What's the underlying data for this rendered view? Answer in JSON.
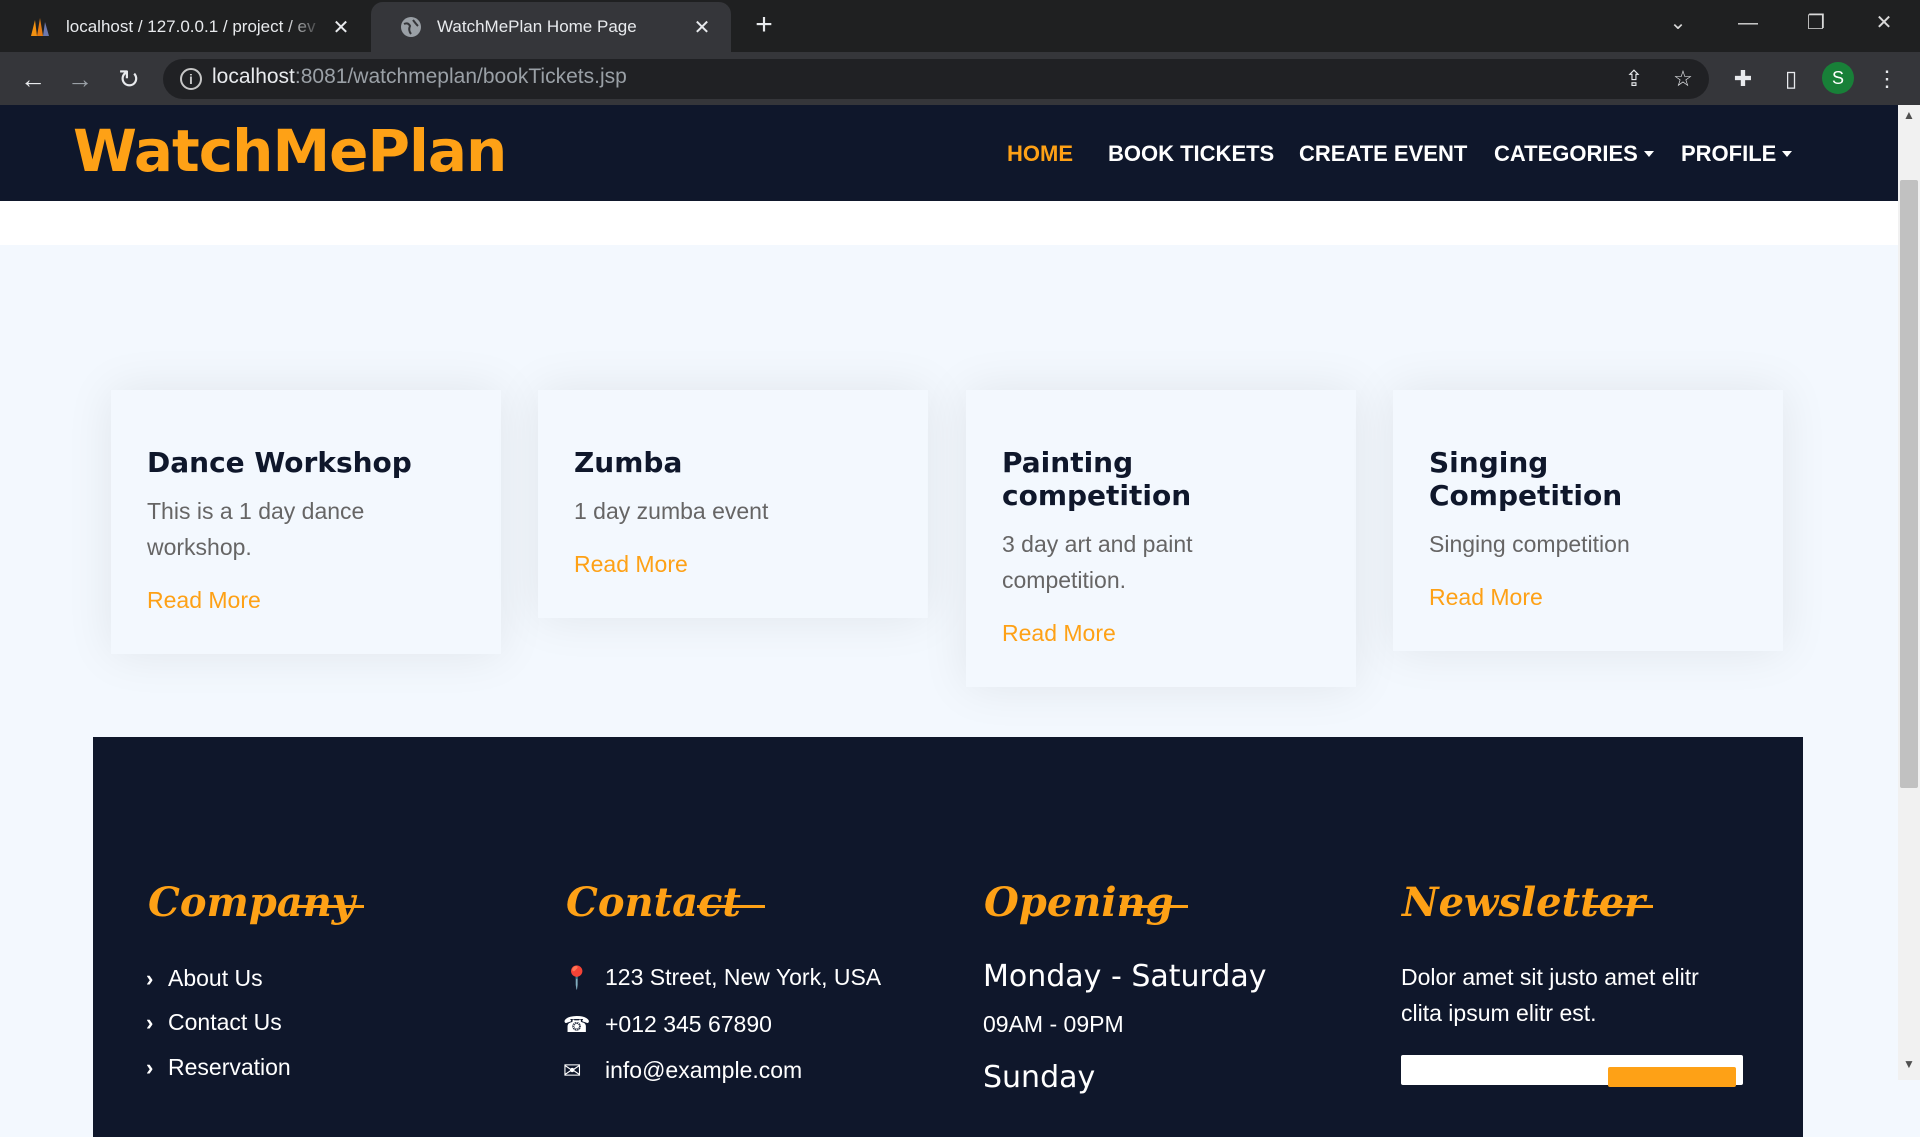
{
  "browser": {
    "tabs": [
      {
        "title": "localhost / 127.0.0.1 / project / ev",
        "active": false,
        "icon": "phpmyadmin-icon"
      },
      {
        "title": "WatchMePlan Home Page",
        "active": true,
        "icon": "globe-icon"
      }
    ],
    "url_host": "localhost",
    "url_rest": ":8081/watchmeplan/bookTickets.jsp",
    "profile_initial": "S"
  },
  "nav": {
    "brand": "WatchMePlan",
    "items": [
      {
        "label": "HOME",
        "active": true
      },
      {
        "label": "BOOK TICKETS"
      },
      {
        "label": "CREATE EVENT"
      },
      {
        "label": "CATEGORIES",
        "dropdown": true
      },
      {
        "label": "PROFILE",
        "dropdown": true
      }
    ]
  },
  "events": [
    {
      "title": "Dance Workshop",
      "description": "This is a 1 day dance workshop.",
      "link": "Read More"
    },
    {
      "title": "Zumba",
      "description": "1 day zumba event",
      "link": "Read More"
    },
    {
      "title": "Painting competition",
      "description": "3 day art and paint competition.",
      "link": "Read More"
    },
    {
      "title": "Singing Competition",
      "description": "Singing competition",
      "link": "Read More"
    }
  ],
  "footer": {
    "company": {
      "heading": "Company",
      "links": [
        "About Us",
        "Contact Us",
        "Reservation"
      ]
    },
    "contact": {
      "heading": "Contact",
      "address": "123 Street, New York, USA",
      "phone": "+012 345 67890",
      "email": "info@example.com"
    },
    "opening": {
      "heading": "Opening",
      "days": "Monday - Saturday",
      "hours": "09AM - 09PM",
      "next_partial": "Sunday"
    },
    "newsletter": {
      "heading": "Newsletter",
      "text_line1": "Dolor amet sit justo amet elitr",
      "text_line2": "clita ipsum elitr est."
    }
  },
  "colors": {
    "accent": "#fea116",
    "dark": "#0f172b",
    "light_bg": "#f3f8fe"
  }
}
